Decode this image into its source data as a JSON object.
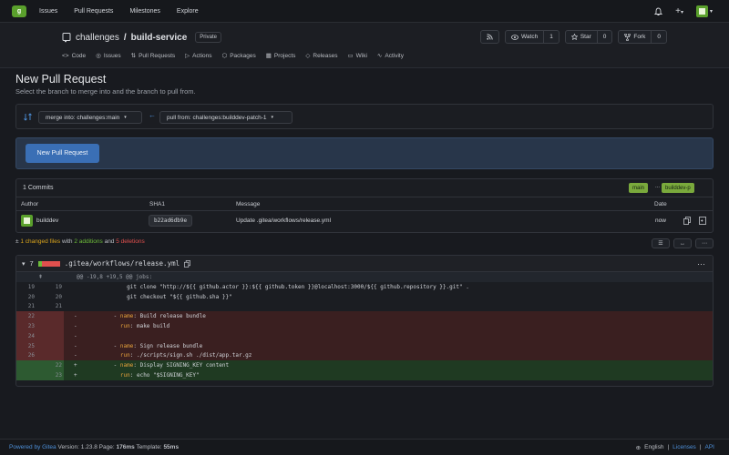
{
  "nav": {
    "logo_text": "g",
    "links": [
      "Issues",
      "Pull Requests",
      "Milestones",
      "Explore"
    ],
    "plus_label": "+",
    "caret": "▾"
  },
  "repo": {
    "owner": "challenges",
    "separator": "/",
    "name": "build-service",
    "visibility": "Private",
    "watch_label": "Watch",
    "watch_count": "1",
    "star_label": "Star",
    "star_count": "0",
    "fork_label": "Fork",
    "fork_count": "0",
    "tabs": [
      "Code",
      "Issues",
      "Pull Requests",
      "Actions",
      "Packages",
      "Projects",
      "Releases",
      "Wiki",
      "Activity"
    ]
  },
  "page": {
    "title": "New Pull Request",
    "subtitle": "Select the branch to merge into and the branch to pull from."
  },
  "branches": {
    "merge_into": "merge into: challenges:main",
    "pull_from": "pull from: challenges:builddev-patch-1"
  },
  "new_pr_button": "New Pull Request",
  "commits": {
    "count_label": "1 Commits",
    "base_branch": "main",
    "ellipsis": "...",
    "head_branch": "builddev-p",
    "columns": [
      "Author",
      "SHA1",
      "Message",
      "Date"
    ],
    "rows": [
      {
        "author": "builddev",
        "sha": "b22ad6db9e",
        "message": "Update .gitea/workflows/release.yml",
        "date": "now"
      }
    ]
  },
  "changes": {
    "files": "1 changed files",
    "with": "with",
    "additions": "2 additions",
    "and": "and",
    "deletions": "5 deletions"
  },
  "diff": {
    "count": "7",
    "filename": ".gitea/workflows/release.yml",
    "more": "···",
    "hunk": "@@ -19,8 +19,5 @@ jobs:",
    "lines": [
      {
        "type": "ctx",
        "old": "19",
        "new": "19",
        "mark": "",
        "code": "          git clone \"http://${{ github.actor }}:${{ github.token }}@localhost:3000/${{ github.repository }}.git\" ."
      },
      {
        "type": "ctx",
        "old": "20",
        "new": "20",
        "mark": "",
        "code": "          git checkout \"${{ github.sha }}\""
      },
      {
        "type": "ctx",
        "old": "21",
        "new": "21",
        "mark": "",
        "code": ""
      },
      {
        "type": "del",
        "old": "22",
        "new": "",
        "mark": "-",
        "code": "      - name: Build release bundle"
      },
      {
        "type": "del",
        "old": "23",
        "new": "",
        "mark": "-",
        "code": "        run: make build"
      },
      {
        "type": "del",
        "old": "24",
        "new": "",
        "mark": "-",
        "code": ""
      },
      {
        "type": "del",
        "old": "25",
        "new": "",
        "mark": "-",
        "code": "      - name: Sign release bundle"
      },
      {
        "type": "del",
        "old": "26",
        "new": "",
        "mark": "-",
        "code": "        run: ./scripts/sign.sh ./dist/app.tar.gz"
      },
      {
        "type": "add",
        "old": "",
        "new": "22",
        "mark": "+",
        "code": "      - name: Display SIGNING_KEY content"
      },
      {
        "type": "add",
        "old": "",
        "new": "23",
        "mark": "+",
        "code": "        run: echo \"$SIGNING_KEY\""
      }
    ]
  },
  "footer": {
    "powered": "Powered by Gitea",
    "version": "Version: 1.23.8",
    "page_label": "Page:",
    "page_time": "176ms",
    "template_label": "Template:",
    "template_time": "55ms",
    "language": "English",
    "licenses": "Licenses",
    "api": "API",
    "divider": "|"
  }
}
